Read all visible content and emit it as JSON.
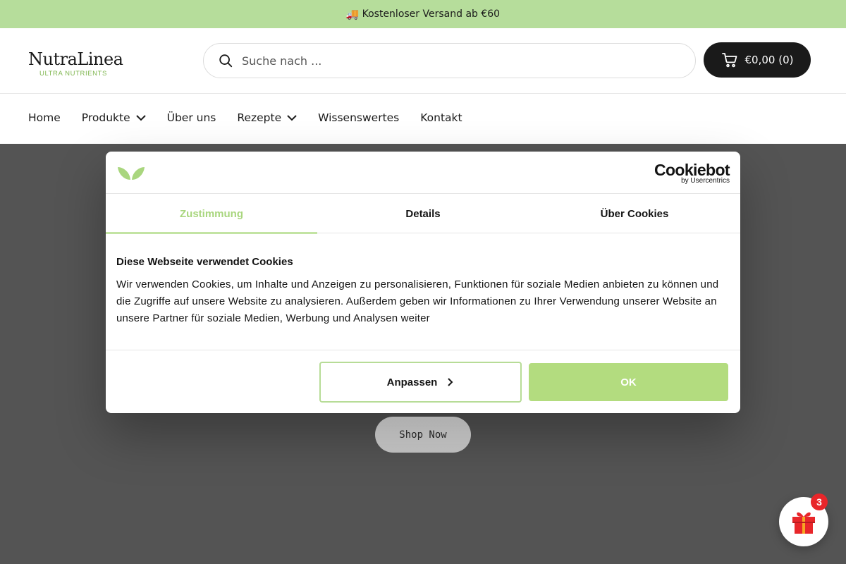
{
  "announcement": {
    "icon": "truck-icon",
    "emoji": "🚚",
    "text": "Kostenloser Versand ab €60"
  },
  "header": {
    "logo_word": "NutraLinea",
    "logo_sub": "ULTRA NUTRIENTS",
    "search_placeholder": "Suche nach ...",
    "cart_label": "€0,00 (0)"
  },
  "nav": {
    "items": [
      {
        "label": "Home",
        "has_dropdown": false
      },
      {
        "label": "Produkte",
        "has_dropdown": true
      },
      {
        "label": "Über uns",
        "has_dropdown": false
      },
      {
        "label": "Rezepte",
        "has_dropdown": true
      },
      {
        "label": "Wissenswertes",
        "has_dropdown": false
      },
      {
        "label": "Kontakt",
        "has_dropdown": false
      }
    ]
  },
  "hero": {
    "button_label": "Shop Now"
  },
  "cookie_dialog": {
    "brand": "Cookiebot",
    "brand_sub": "by Usercentrics",
    "tabs": [
      {
        "label": "Zustimmung",
        "active": true
      },
      {
        "label": "Details",
        "active": false
      },
      {
        "label": "Über Cookies",
        "active": false
      }
    ],
    "heading": "Diese Webseite verwendet Cookies",
    "text": "Wir verwenden Cookies, um Inhalte und Anzeigen zu personalisieren, Funktionen für soziale Medien anbieten zu können und die Zugriffe auf unsere Website zu analysieren. Außerdem geben wir Informationen zu Ihrer Verwendung unserer Website an unsere Partner für soziale Medien, Werbung und Analysen weiter",
    "customize_label": "Anpassen",
    "ok_label": "OK"
  },
  "gift_widget": {
    "badge_count": "3"
  },
  "colors": {
    "announcement_bg": "#b6dd9b",
    "accent_green": "#b3dc7f",
    "overlay": "#545454",
    "dark": "#1a1a1a",
    "badge_red": "#e8262a"
  }
}
